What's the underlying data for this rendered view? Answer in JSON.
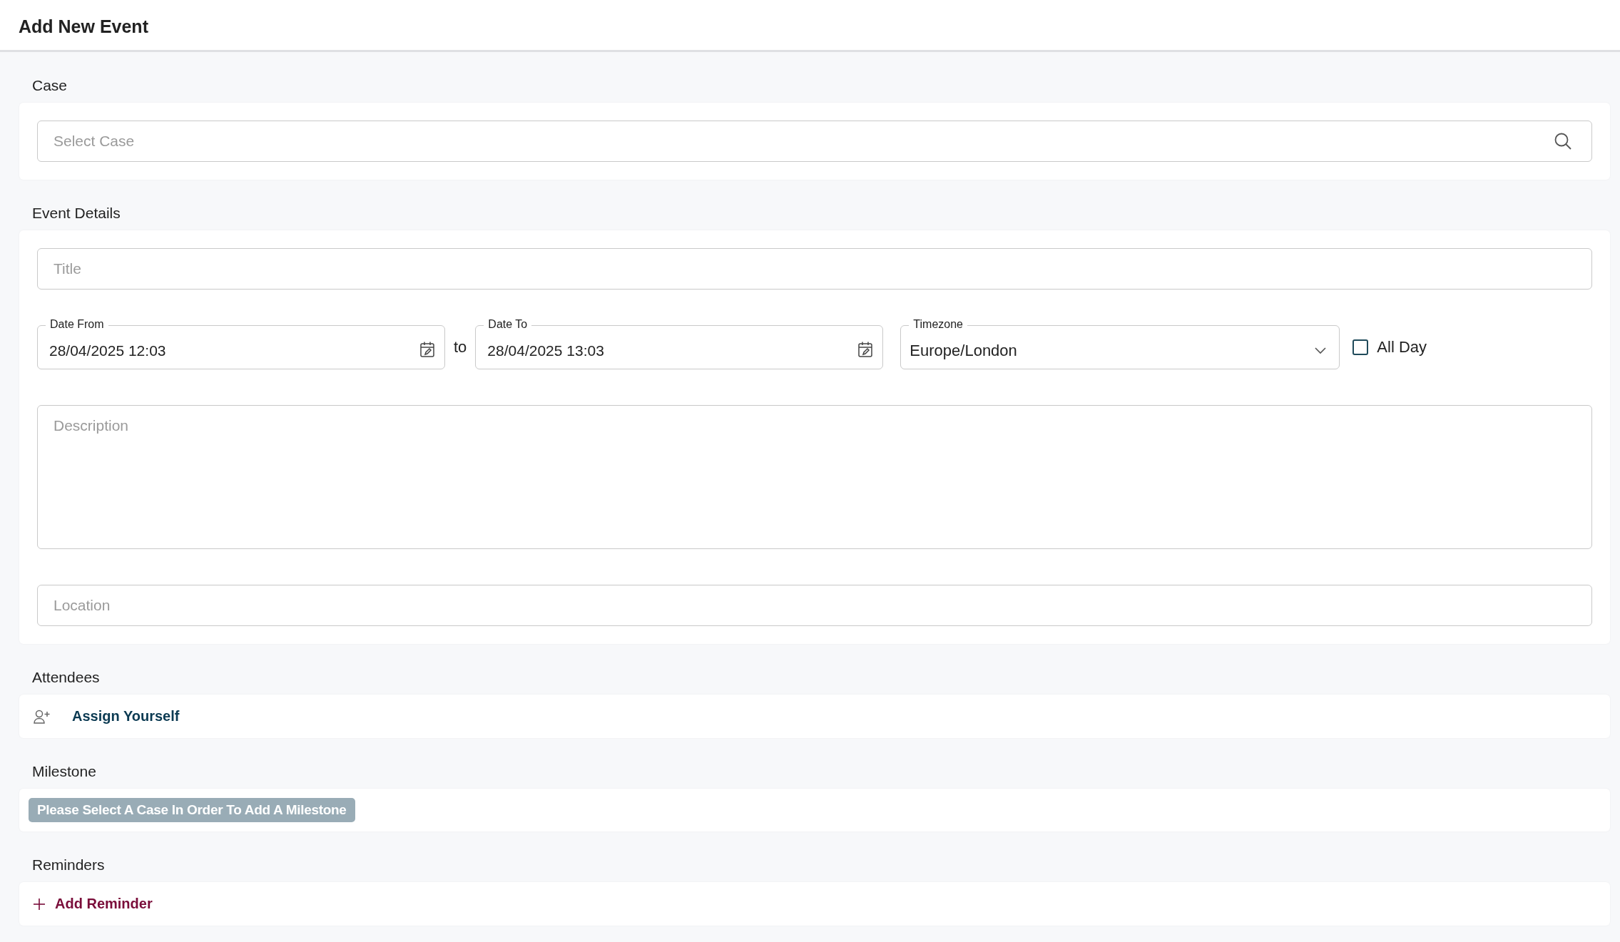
{
  "header": {
    "title": "Add New Event"
  },
  "sections": [
    {
      "kind": "case",
      "label": "Case",
      "search": {
        "placeholder": "Select Case"
      }
    },
    {
      "kind": "details",
      "label": "Event Details",
      "title_field": {
        "placeholder": "Title"
      },
      "date_from": {
        "label": "Date From",
        "value": "28/04/2025 12:03"
      },
      "separator": "to",
      "date_to": {
        "label": "Date To",
        "value": "28/04/2025 13:03"
      },
      "timezone": {
        "label": "Timezone",
        "value": "Europe/London"
      },
      "all_day": {
        "label": "All Day",
        "checked": false
      },
      "description": {
        "placeholder": "Description"
      },
      "location": {
        "placeholder": "Location"
      }
    },
    {
      "kind": "attendees",
      "label": "Attendees",
      "action": "Assign Yourself"
    },
    {
      "kind": "milestone",
      "label": "Milestone",
      "notice": "Please Select A Case In Order To Add A Milestone"
    },
    {
      "kind": "reminders",
      "label": "Reminders",
      "action": "Add Reminder"
    }
  ]
}
